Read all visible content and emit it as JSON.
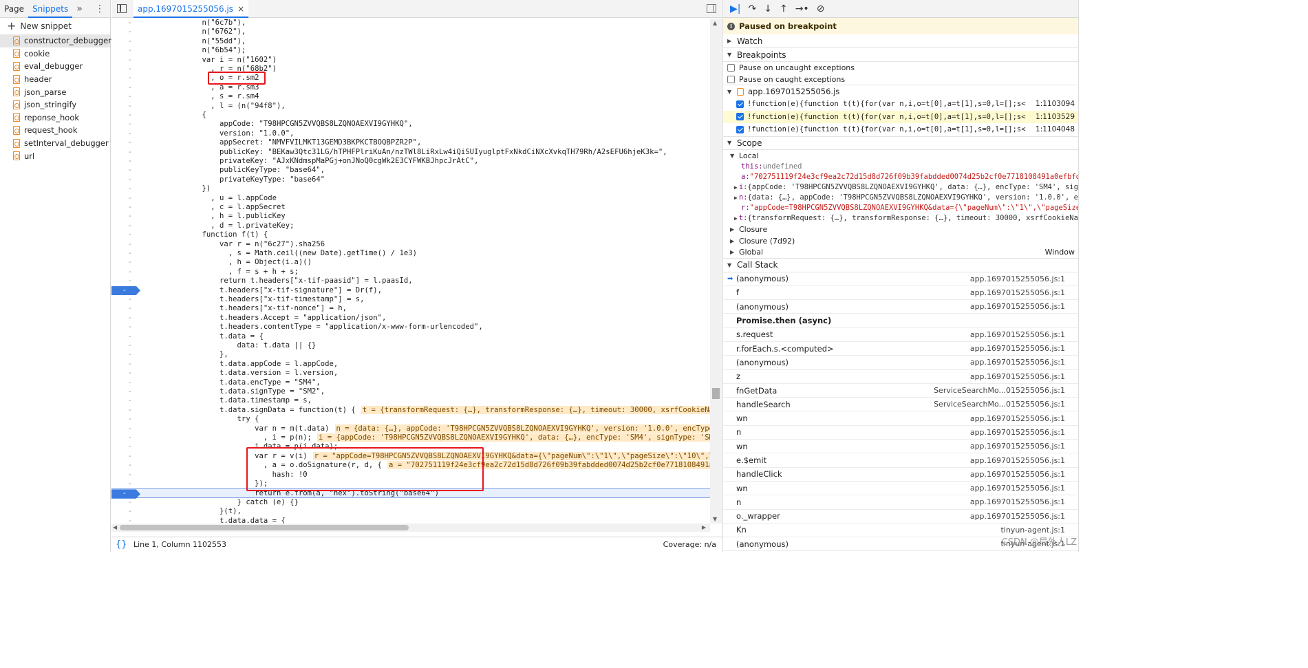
{
  "nav": {
    "tabs": [
      "Page",
      "Snippets"
    ],
    "more_icon": "»",
    "menu_icon": "⋮",
    "new_snippet": "New snippet",
    "snippets": [
      "constructor_debugger",
      "cookie",
      "eval_debugger",
      "header",
      "json_parse",
      "json_stringify",
      "reponse_hook",
      "request_hook",
      "setInterval_debugger",
      "url"
    ]
  },
  "editor": {
    "tab_title": "app.1697015255056.js",
    "close_icon": "×",
    "lines": [
      {
        "t": "            n(\"6c7b\"),"
      },
      {
        "t": "            n(\"6762\"),"
      },
      {
        "t": "            n(\"55dd\"),"
      },
      {
        "t": "            n(\"6b54\");"
      },
      {
        "t": "            var i = n(\"1602\")"
      },
      {
        "t": "              , r = n(\"68b2\")"
      },
      {
        "t": "              , o = r.sm2"
      },
      {
        "t": "              , a = r.sm3"
      },
      {
        "t": "              , s = r.sm4"
      },
      {
        "t": "              , l = (n(\"94f8\"),"
      },
      {
        "t": "            {"
      },
      {
        "t": "                appCode: \"T98HPCGN5ZVVQBS8LZQNOAEXVI9GYHKQ\","
      },
      {
        "t": "                version: \"1.0.0\","
      },
      {
        "t": "                appSecret: \"NMVFVILMKT13GEMD3BKPKCTBOQBPZR2P\","
      },
      {
        "t": "                publicKey: \"BEKaw3Qtc31LG/hTPHFPlriKuAn/nzTWl8LiRxLw4iQiSUIyuglptFxNkdCiNXcXvkqTH79Rh/A2sEFU6hjeK3k=\","
      },
      {
        "t": "                privateKey: \"AJxKNdmspMaPGj+onJNoQ0cgWk2E3CYFWKBJhpcJrAtC\","
      },
      {
        "t": "                publicKeyType: \"base64\","
      },
      {
        "t": "                privateKeyType: \"base64\""
      },
      {
        "t": "            })"
      },
      {
        "t": "              , u = l.appCode"
      },
      {
        "t": "              , c = l.appSecret"
      },
      {
        "t": "              , h = l.publicKey"
      },
      {
        "t": "              , d = l.privateKey;"
      },
      {
        "t": "            function f(t) {"
      },
      {
        "t": "                var r = n(\"6c27\").sha256"
      },
      {
        "t": "                  , s = Math.ceil((new Date).getTime() / 1e3)"
      },
      {
        "t": "                  , h = Object(i.a)()"
      },
      {
        "t": "                  , f = s + h + s;"
      },
      {
        "t": "                return t.headers[\"x-tif-paasid\"] = l.paasId,"
      },
      {
        "t": "                t.headers[\"x-tif-signature\"] = Dr(f),",
        "bp": true
      },
      {
        "t": "                t.headers[\"x-tif-timestamp\"] = s,"
      },
      {
        "t": "                t.headers[\"x-tif-nonce\"] = h,"
      },
      {
        "t": "                t.headers.Accept = \"application/json\","
      },
      {
        "t": "                t.headers.contentType = \"application/x-www-form-urlencoded\","
      },
      {
        "t": "                t.data = {"
      },
      {
        "t": "                    data: t.data || {}"
      },
      {
        "t": "                },"
      },
      {
        "t": "                t.data.appCode = l.appCode,"
      },
      {
        "t": "                t.data.version = l.version,"
      },
      {
        "t": "                t.data.encType = \"SM4\","
      },
      {
        "t": "                t.data.signType = \"SM2\","
      },
      {
        "t": "                t.data.timestamp = s,"
      },
      {
        "t": "                t.data.signData = function(t) {",
        "inl": "t = {transformRequest: {…}, transformResponse: {…}, timeout: 30000, xsrfCookieName: 'XSRF"
      },
      {
        "t": "                    try {"
      },
      {
        "t": "                        var n = m(t.data)",
        "inl": "n = {data: {…}, appCode: 'T98HPCGN5ZVVQBS8LZQNOAEXVI9GYHKQ', version: '1.0.0', encType: 'SM4'"
      },
      {
        "t": "                          , i = p(n);",
        "inl": "i = {appCode: 'T98HPCGN5ZVVQBS8LZQNOAEXVI9GYHKQ', data: {…}, encType: 'SM4', signType: 'SM2', ti"
      },
      {
        "t": "                        i.data = p(i.data);"
      },
      {
        "t": "                        var r = v(i)",
        "inl": "r = \"appCode=T98HPCGN5ZVVQBS8LZQNOAEXVI9GYHKQ&data={\\\"pageNum\\\":\\\"1\\\",\\\"pageSize\\\":\\\"10\\\",\\\"queryParam"
      },
      {
        "t": "                          , a = o.doSignature(r, d, {",
        "inl": "a = \"702751119f24e3cf9ea2c72d15d8d726f09b39fabdded0074d25b2cf0e7718108491a0efbfdca8"
      },
      {
        "t": "                            hash: !0"
      },
      {
        "t": "                        });"
      },
      {
        "t": "                        return e.from(a, \"hex\").toString(\"base64\")",
        "bp": true,
        "cur": true
      },
      {
        "t": "                    } catch (e) {}"
      },
      {
        "t": "                }(t),"
      },
      {
        "t": "                t.data.data = {"
      }
    ],
    "status_position": "Line 1, Column 1102553",
    "status_coverage": "Coverage: n/a"
  },
  "debugger": {
    "paused_text": "Paused on breakpoint",
    "watch": "Watch",
    "breakpoints": "Breakpoints",
    "pause_uncaught": "Pause on uncaught exceptions",
    "pause_caught": "Pause on caught exceptions",
    "bp_file": "app.1697015255056.js",
    "bp_items": [
      {
        "code": "!function(e){function t(t){for(var n,i,o=t[0],a=t[1],s=0,l=[];s<o…",
        "line": "1:1103094"
      },
      {
        "code": "!function(e){function t(t){for(var n,i,o=t[0],a=t[1],s=0,l=[];s<o…",
        "line": "1:1103529"
      },
      {
        "code": "!function(e){function t(t){for(var n,i,o=t[0],a=t[1],s=0,l=[];s<o…",
        "line": "1:1104048"
      }
    ],
    "scope": "Scope",
    "local": "Local",
    "scope_vars": [
      {
        "k": "this:",
        "v": " undefined",
        "type": "dim"
      },
      {
        "k": "a:",
        "v": " \"702751119f24e3cf9ea2c72d15d8d726f09b39fabdded0074d25b2cf0e7718108491a0efbfdca8",
        "type": "str"
      },
      {
        "k": "i:",
        "v": " {appCode: 'T98HPCGN5ZVVQBS8LZQNOAEXVI9GYHKQ', data: {…}, encType: 'SM4', signType",
        "type": "obj"
      },
      {
        "k": "n:",
        "v": " {data: {…}, appCode: 'T98HPCGN5ZVVQBS8LZQNOAEXVI9GYHKQ', version: '1.0.0', encT",
        "type": "obj"
      },
      {
        "k": "r:",
        "v": " \"appCode=T98HPCGN5ZVVQBS8LZQNOAEXVI9GYHKQ&data={\\\"pageNum\\\":\\\"1\\\",\\\"pageSize\\\":",
        "type": "str"
      },
      {
        "k": "t:",
        "v": " {transformRequest: {…}, transformResponse: {…}, timeout: 30000, xsrfCookieName:",
        "type": "obj"
      }
    ],
    "closure": "Closure",
    "closure2": "Closure (7d92)",
    "global": "Global",
    "global_val": "Window",
    "call_stack": "Call Stack",
    "stack": [
      {
        "fn": "(anonymous)",
        "loc": "app.1697015255056.js:1",
        "cur": true
      },
      {
        "fn": "f",
        "loc": "app.1697015255056.js:1"
      },
      {
        "fn": "(anonymous)",
        "loc": "app.1697015255056.js:1"
      },
      {
        "fn": "Promise.then (async)",
        "loc": "",
        "async": true
      },
      {
        "fn": "s.request",
        "loc": "app.1697015255056.js:1"
      },
      {
        "fn": "r.forEach.s.<computed>",
        "loc": "app.1697015255056.js:1"
      },
      {
        "fn": "(anonymous)",
        "loc": "app.1697015255056.js:1"
      },
      {
        "fn": "z",
        "loc": "app.1697015255056.js:1"
      },
      {
        "fn": "fnGetData",
        "loc": "ServiceSearchMo...015255056.js:1"
      },
      {
        "fn": "handleSearch",
        "loc": "ServiceSearchMo...015255056.js:1"
      },
      {
        "fn": "wn",
        "loc": "app.1697015255056.js:1"
      },
      {
        "fn": "n",
        "loc": "app.1697015255056.js:1"
      },
      {
        "fn": "wn",
        "loc": "app.1697015255056.js:1"
      },
      {
        "fn": "e.$emit",
        "loc": "app.1697015255056.js:1"
      },
      {
        "fn": "handleClick",
        "loc": "app.1697015255056.js:1"
      },
      {
        "fn": "wn",
        "loc": "app.1697015255056.js:1"
      },
      {
        "fn": "n",
        "loc": "app.1697015255056.js:1"
      },
      {
        "fn": "o._wrapper",
        "loc": "app.1697015255056.js:1"
      },
      {
        "fn": "Kn",
        "loc": "tinyun-agent.js:1"
      },
      {
        "fn": "(anonymous)",
        "loc": "tinyun-agent.js:1"
      }
    ],
    "watermark": "CSDN @局外人LZ"
  }
}
